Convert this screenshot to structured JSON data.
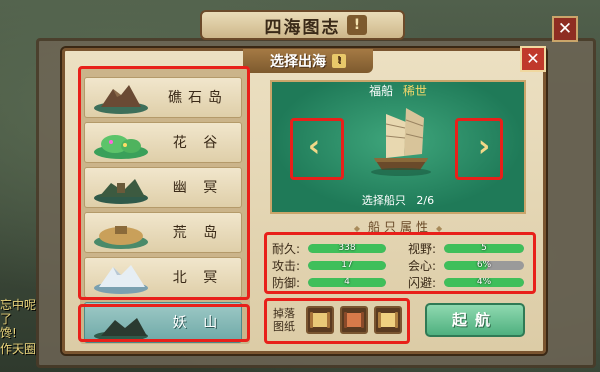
{
  "window": {
    "title": "四海图志",
    "info_icon": "exclamation-icon",
    "close_icon": "close-icon"
  },
  "dialog": {
    "title": "选择出海",
    "help_icon": "exclamation-icon",
    "close_icon": "close-icon"
  },
  "islands": [
    {
      "name": "礁石岛",
      "icon": "rock-island-icon",
      "selected": false
    },
    {
      "name": "花 谷",
      "icon": "flower-valley-icon",
      "selected": false
    },
    {
      "name": "幽 冥",
      "icon": "dark-island-icon",
      "selected": false
    },
    {
      "name": "荒 岛",
      "icon": "desert-island-icon",
      "selected": false
    },
    {
      "name": "北 冥",
      "icon": "snow-island-icon",
      "selected": false
    },
    {
      "name": "妖 山",
      "icon": "demon-mountain-icon",
      "selected": true
    }
  ],
  "ship": {
    "name": "福船",
    "rarity": "稀世",
    "count_label": "选择船只",
    "count": "2/6",
    "icon": "junk-ship-icon"
  },
  "attributes": {
    "title": "船只属性",
    "left": [
      {
        "label": "耐久:",
        "value": "338",
        "fill": 1.0
      },
      {
        "label": "攻击:",
        "value": "17",
        "fill": 1.0
      },
      {
        "label": "防御:",
        "value": "4",
        "fill": 1.0
      }
    ],
    "right": [
      {
        "label": "视野:",
        "value": "5",
        "fill": 1.0
      },
      {
        "label": "会心:",
        "value": "6%",
        "fill": 0.55
      },
      {
        "label": "闪避:",
        "value": "4%",
        "fill": 1.0
      }
    ]
  },
  "drops": {
    "label": "掉落图纸",
    "items": [
      "scroll-map-icon",
      "scroll-map-icon",
      "scroll-map-icon"
    ]
  },
  "sail_button": "起航",
  "background_text": [
    "忘中呢",
    "了",
    "馋!",
    "作天圈"
  ],
  "colors": {
    "highlight": "#e8201a",
    "panel_green": "#1f7a58",
    "bar_green": "#3fbf5a"
  }
}
